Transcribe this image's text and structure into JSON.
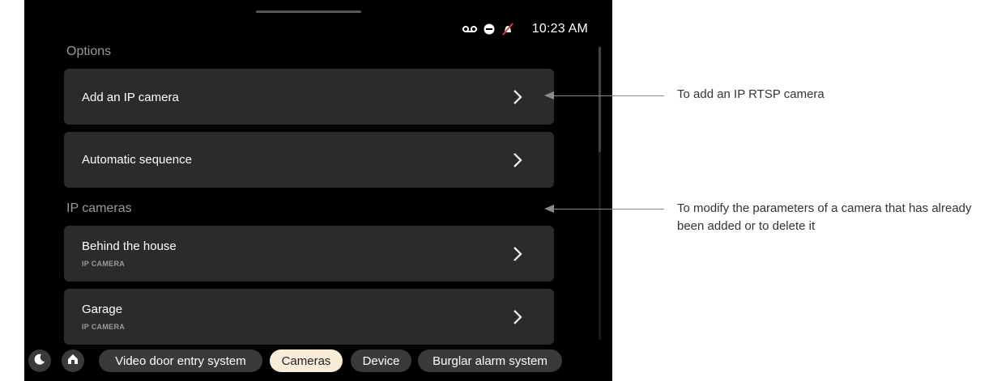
{
  "status_bar": {
    "time": "10:23 AM",
    "icons": [
      "voicemail-icon",
      "do-not-disturb-icon",
      "muted-bell-icon"
    ]
  },
  "sections": {
    "options_title": "Options",
    "ip_cameras_title": "IP cameras"
  },
  "options": [
    {
      "label": "Add an IP camera"
    },
    {
      "label": "Automatic sequence"
    }
  ],
  "cameras": [
    {
      "label": "Behind the house",
      "sub": "IP CAMERA"
    },
    {
      "label": "Garage",
      "sub": "IP CAMERA"
    }
  ],
  "bottom_nav": {
    "tabs": [
      {
        "label": "Video door entry system"
      },
      {
        "label": "Cameras",
        "active": true
      },
      {
        "label": "Device"
      },
      {
        "label": "Burglar alarm system"
      }
    ]
  },
  "annotations": [
    {
      "text": "To add an IP RTSP camera"
    },
    {
      "text": "To modify the parameters of a camera that has already been added or to delete it"
    }
  ],
  "colors": {
    "background": "#000000",
    "card": "#2b2b2b",
    "active_tab": "#fbecd8",
    "muted_text": "#9a9a9a"
  }
}
